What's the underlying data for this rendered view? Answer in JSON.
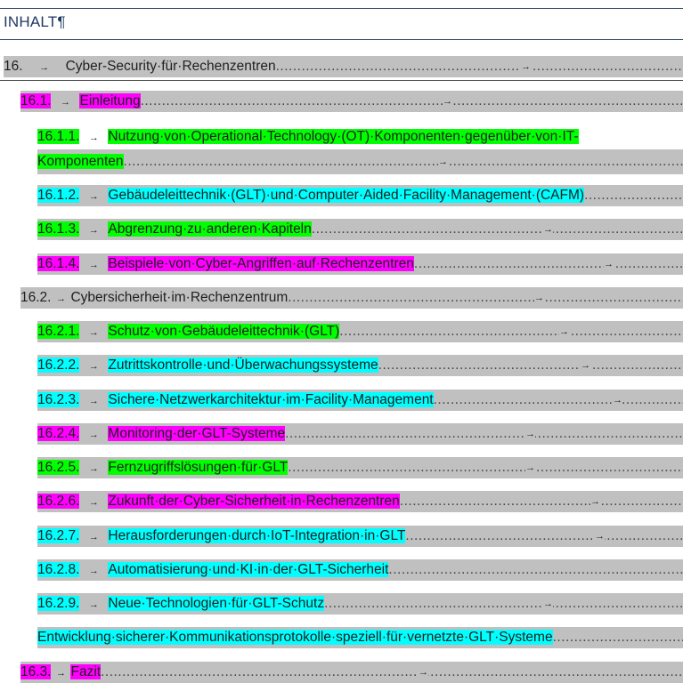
{
  "heading": "INHALT¶",
  "entries": [
    {
      "num": "16.",
      "title": "Cyber-Security·für·Rechenzentren",
      "num_hl": "",
      "title_hl": ""
    },
    {
      "num": "16.1.",
      "title": "Einleitung",
      "num_hl": "#ff00ff",
      "title_hl": "#ff00ff"
    },
    {
      "num": "16.1.1.",
      "title_line1": "Nutzung·von·Operational·Technology·(OT)·Komponenten·gegenüber·von·IT-",
      "title_line2": "Komponenten",
      "num_hl": "#00ff00",
      "title_hl": "#00ff00"
    },
    {
      "num": "16.1.2.",
      "title": "Gebäudeleittechnik·(GLT)·und·Computer·Aided·Facility·Management·(CAFM)",
      "num_hl": "#00ffff",
      "title_hl": "#00ffff"
    },
    {
      "num": "16.1.3.",
      "title": "Abgrenzung·zu·anderen·Kapiteln",
      "num_hl": "#00ff00",
      "title_hl": "#00ff00"
    },
    {
      "num": "16.1.4.",
      "title": "Beispiele·von·Cyber-Angriffen·auf·Rechenzentren",
      "num_hl": "#ff00ff",
      "title_hl": "#ff00ff"
    },
    {
      "num": "16.2.",
      "title": "Cybersicherheit·im·Rechenzentrum",
      "num_hl": "",
      "title_hl": ""
    },
    {
      "num": "16.2.1.",
      "title": "Schutz·von·Gebäudeleittechnik·(GLT)",
      "num_hl": "#00ff00",
      "title_hl": "#00ff00"
    },
    {
      "num": "16.2.2.",
      "title": "Zutrittskontrolle·und·Überwachungssysteme",
      "num_hl": "#00ffff",
      "title_hl": "#00ffff"
    },
    {
      "num": "16.2.3.",
      "title": "Sichere·Netzwerkarchitektur·im·Facility·Management",
      "num_hl": "#00ffff",
      "title_hl": "#00ffff"
    },
    {
      "num": "16.2.4.",
      "title": "Monitoring·der·GLT-Systeme",
      "num_hl": "#ff00ff",
      "title_hl": "#ff00ff"
    },
    {
      "num": "16.2.5.",
      "title": "Fernzugriffslösungen·für·GLT",
      "num_hl": "#00ff00",
      "title_hl": "#00ff00"
    },
    {
      "num": "16.2.6.",
      "title": "Zukunft·der·Cyber-Sicherheit·in·Rechenzentren",
      "num_hl": "#ff00ff",
      "title_hl": "#ff00ff"
    },
    {
      "num": "16.2.7.",
      "title": "Herausforderungen·durch·IoT-Integration·in·GLT",
      "num_hl": "#00ffff",
      "title_hl": "#00ffff"
    },
    {
      "num": "16.2.8.",
      "title": "Automatisierung·und·KI·in·der·GLT-Sicherheit",
      "num_hl": "#00ffff",
      "title_hl": "#00ffff"
    },
    {
      "num": "16.2.9.",
      "title": "Neue·Technologien·für·GLT-Schutz",
      "num_hl": "#00ffff",
      "title_hl": "#00ffff"
    },
    {
      "num": "",
      "title": "Entwicklung·sicherer·Kommunikationsprotokolle·speziell·für·vernetzte·GLT·Systeme",
      "num_hl": "",
      "title_hl": "#00ffff"
    },
    {
      "num": "16.3.",
      "title": "Fazit",
      "num_hl": "#ff00ff",
      "title_hl": "#ff00ff"
    }
  ],
  "tab_glyph": "→",
  "leader": "........................................................................................................................................................................................"
}
